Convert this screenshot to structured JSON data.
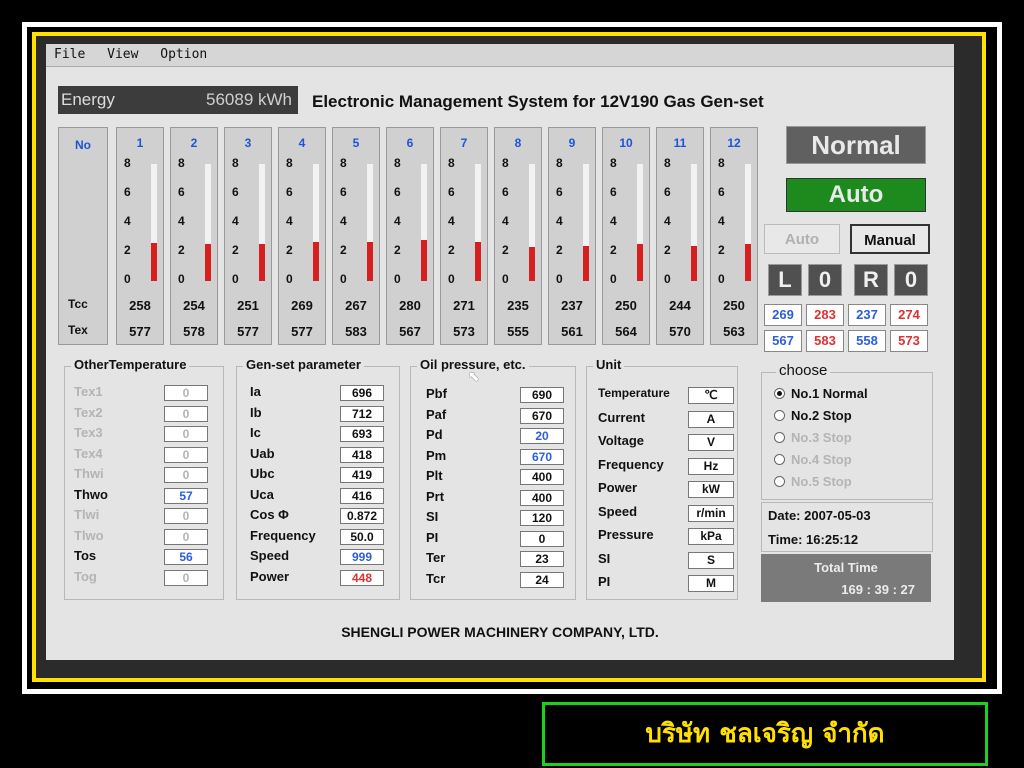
{
  "menu": [
    "File",
    "View",
    "Option"
  ],
  "energy": {
    "label": "Energy",
    "value": "56089 kWh"
  },
  "title": "Electronic Management System for 12V190 Gas Gen-set",
  "cylinders": {
    "header": "No",
    "ticks": [
      "8",
      "6",
      "4",
      "2",
      "0"
    ],
    "row_tcc": "Tcc",
    "row_tex": "Tex",
    "items": [
      {
        "no": "1",
        "level": 2.6,
        "tcc": "258",
        "tex": "577"
      },
      {
        "no": "2",
        "level": 2.5,
        "tcc": "254",
        "tex": "578"
      },
      {
        "no": "3",
        "level": 2.5,
        "tcc": "251",
        "tex": "577"
      },
      {
        "no": "4",
        "level": 2.7,
        "tcc": "269",
        "tex": "577"
      },
      {
        "no": "5",
        "level": 2.7,
        "tcc": "267",
        "tex": "583"
      },
      {
        "no": "6",
        "level": 2.8,
        "tcc": "280",
        "tex": "567"
      },
      {
        "no": "7",
        "level": 2.7,
        "tcc": "271",
        "tex": "573"
      },
      {
        "no": "8",
        "level": 2.3,
        "tcc": "235",
        "tex": "555"
      },
      {
        "no": "9",
        "level": 2.4,
        "tcc": "237",
        "tex": "561"
      },
      {
        "no": "10",
        "level": 2.5,
        "tcc": "250",
        "tex": "564"
      },
      {
        "no": "11",
        "level": 2.4,
        "tcc": "244",
        "tex": "570"
      },
      {
        "no": "12",
        "level": 2.5,
        "tcc": "250",
        "tex": "563"
      }
    ]
  },
  "status": {
    "state": "Normal",
    "mode": "Auto",
    "btn_auto": "Auto",
    "btn_manual": "Manual"
  },
  "lor": [
    "L",
    "0",
    "R",
    "0"
  ],
  "mini_tcc": [
    {
      "v": "269",
      "color": "#2a5de0"
    },
    {
      "v": "283",
      "color": "#e03030"
    },
    {
      "v": "237",
      "color": "#2a5de0"
    },
    {
      "v": "274",
      "color": "#e03030"
    }
  ],
  "mini_tex": [
    {
      "v": "567",
      "color": "#2a5de0"
    },
    {
      "v": "583",
      "color": "#e03030"
    },
    {
      "v": "558",
      "color": "#2a5de0"
    },
    {
      "v": "573",
      "color": "#e03030"
    }
  ],
  "other_temp": {
    "title": "OtherTemperature",
    "items": [
      {
        "label": "Tex1",
        "value": "0",
        "active": false
      },
      {
        "label": "Tex2",
        "value": "0",
        "active": false
      },
      {
        "label": "Tex3",
        "value": "0",
        "active": false
      },
      {
        "label": "Tex4",
        "value": "0",
        "active": false
      },
      {
        "label": "Thwi",
        "value": "0",
        "active": false
      },
      {
        "label": "Thwo",
        "value": "57",
        "active": true
      },
      {
        "label": "Tlwi",
        "value": "0",
        "active": false
      },
      {
        "label": "Tlwo",
        "value": "0",
        "active": false
      },
      {
        "label": "Tos",
        "value": "56",
        "active": true
      },
      {
        "label": "Tog",
        "value": "0",
        "active": false
      }
    ]
  },
  "genset": {
    "title": "Gen-set parameter",
    "items": [
      {
        "label": "Ia",
        "value": "696",
        "color": "#111"
      },
      {
        "label": "Ib",
        "value": "712",
        "color": "#111"
      },
      {
        "label": "Ic",
        "value": "693",
        "color": "#111"
      },
      {
        "label": "Uab",
        "value": "418",
        "color": "#111"
      },
      {
        "label": "Ubc",
        "value": "419",
        "color": "#111"
      },
      {
        "label": "Uca",
        "value": "416",
        "color": "#111"
      },
      {
        "label": "Cos Φ",
        "value": "0.872",
        "color": "#111"
      },
      {
        "label": "Frequency",
        "value": "50.0",
        "color": "#111"
      },
      {
        "label": "Speed",
        "value": "999",
        "color": "#2a5de0"
      },
      {
        "label": "Power",
        "value": "448",
        "color": "#e03030"
      }
    ]
  },
  "oil": {
    "title": "Oil pressure, etc.",
    "items": [
      {
        "label": "Pbf",
        "value": "690",
        "color": "#111"
      },
      {
        "label": "Paf",
        "value": "670",
        "color": "#111"
      },
      {
        "label": "Pd",
        "value": "20",
        "color": "#2a5de0"
      },
      {
        "label": "Pm",
        "value": "670",
        "color": "#2a5de0"
      },
      {
        "label": "Plt",
        "value": "400",
        "color": "#111"
      },
      {
        "label": "Prt",
        "value": "400",
        "color": "#111"
      },
      {
        "label": "SI",
        "value": "120",
        "color": "#111"
      },
      {
        "label": "PI",
        "value": "0",
        "color": "#111"
      },
      {
        "label": "Ter",
        "value": "23",
        "color": "#111"
      },
      {
        "label": "Tcr",
        "value": "24",
        "color": "#111"
      }
    ]
  },
  "unit": {
    "title": "Unit",
    "items": [
      {
        "label": "Temperature",
        "value": "℃"
      },
      {
        "label": "Current",
        "value": "A"
      },
      {
        "label": "Voltage",
        "value": "V"
      },
      {
        "label": "Frequency",
        "value": "Hz"
      },
      {
        "label": "Power",
        "value": "kW"
      },
      {
        "label": "Speed",
        "value": "r/min"
      },
      {
        "label": "Pressure",
        "value": "kPa"
      },
      {
        "label": "SI",
        "value": "S"
      },
      {
        "label": "PI",
        "value": "M"
      }
    ]
  },
  "choose": {
    "title": "choose",
    "options": [
      {
        "label": "No.1 Normal",
        "checked": true,
        "enabled": true
      },
      {
        "label": "No.2 Stop",
        "checked": false,
        "enabled": true
      },
      {
        "label": "No.3 Stop",
        "checked": false,
        "enabled": false
      },
      {
        "label": "No.4 Stop",
        "checked": false,
        "enabled": false
      },
      {
        "label": "No.5 Stop",
        "checked": false,
        "enabled": false
      }
    ]
  },
  "date": "Date:  2007-05-03",
  "time": "Time:  16:25:12",
  "total_time": {
    "label": "Total Time",
    "value": "169 : 39 : 27"
  },
  "footer": "SHENGLI POWER MACHINERY COMPANY, LTD.",
  "thai_caption": "บริษัท ชลเจริญ จำกัด",
  "colors": {
    "accent_blue": "#2a5de0",
    "alarm_red": "#e03030",
    "auto_green": "#1d8a1d",
    "frame_yellow": "#ffe000",
    "caption_green": "#1fd11f"
  }
}
